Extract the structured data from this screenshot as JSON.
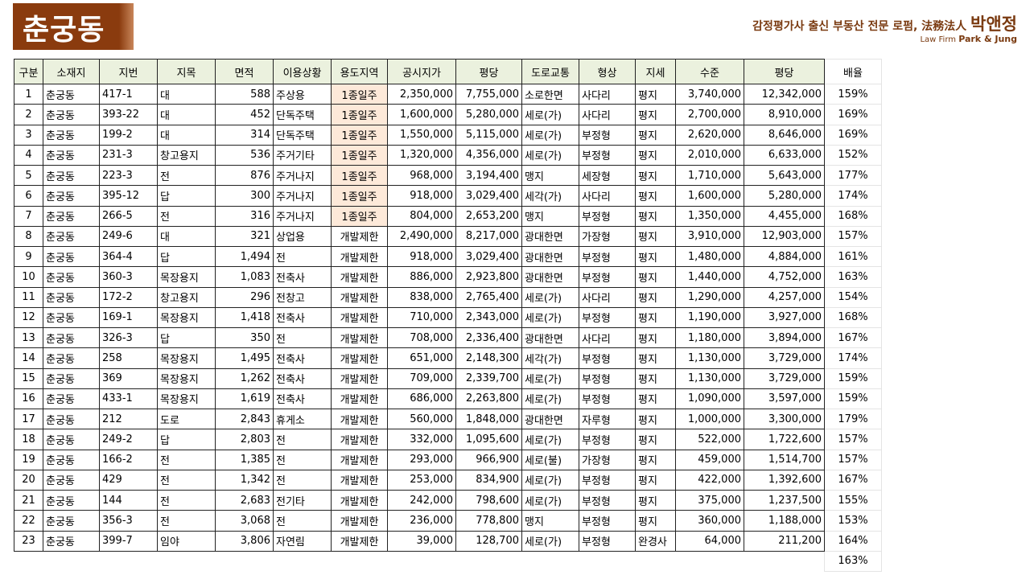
{
  "title": "춘궁동",
  "firm": {
    "line1": "감정평가사 출신 부동산 전문 로펌, 法務法人",
    "name": "박앤정",
    "line2_prefix": "Law Firm",
    "line2_name": "Park & Jung"
  },
  "headers": [
    "구분",
    "소재지",
    "지번",
    "지목",
    "면적",
    "이용상황",
    "용도지역",
    "공시지가",
    "평당",
    "도로교통",
    "형상",
    "지세",
    "수준",
    "평당",
    "배율"
  ],
  "rows": [
    {
      "no": "1",
      "no_red": true,
      "loc": "춘궁동",
      "lot": "417-1",
      "jimok": "대",
      "area": "588",
      "use": "주상용",
      "zone": "1종일주",
      "price": "2,350,000",
      "pp": "7,755,000",
      "road": "소로한면",
      "shape": "사다리",
      "terrain": "평지",
      "level": "3,740,000",
      "lpp": "12,342,000",
      "ratio": "159%"
    },
    {
      "no": "2",
      "no_red": true,
      "loc": "춘궁동",
      "lot": "393-22",
      "jimok": "대",
      "area": "452",
      "use": "단독주택",
      "zone": "1종일주",
      "price": "1,600,000",
      "pp": "5,280,000",
      "road": "세로(가)",
      "shape": "사다리",
      "terrain": "평지",
      "level": "2,700,000",
      "lpp": "8,910,000",
      "ratio": "169%"
    },
    {
      "no": "3",
      "no_red": false,
      "loc": "춘궁동",
      "lot": "199-2",
      "jimok": "대",
      "area": "314",
      "use": "단독주택",
      "zone": "1종일주",
      "price": "1,550,000",
      "pp": "5,115,000",
      "road": "세로(가)",
      "shape": "부정형",
      "terrain": "평지",
      "level": "2,620,000",
      "lpp": "8,646,000",
      "ratio": "169%"
    },
    {
      "no": "4",
      "no_red": true,
      "loc": "춘궁동",
      "lot": "231-3",
      "jimok": "창고용지",
      "area": "536",
      "use": "주거기타",
      "zone": "1종일주",
      "price": "1,320,000",
      "pp": "4,356,000",
      "road": "세로(가)",
      "shape": "부정형",
      "terrain": "평지",
      "level": "2,010,000",
      "lpp": "6,633,000",
      "ratio": "152%"
    },
    {
      "no": "5",
      "no_red": false,
      "loc": "춘궁동",
      "lot": "223-3",
      "jimok": "전",
      "area": "876",
      "use": "주거나지",
      "zone": "1종일주",
      "price": "968,000",
      "pp": "3,194,400",
      "road": "맹지",
      "shape": "세장형",
      "terrain": "평지",
      "level": "1,710,000",
      "lpp": "5,643,000",
      "ratio": "177%"
    },
    {
      "no": "6",
      "no_red": false,
      "loc": "춘궁동",
      "lot": "395-12",
      "jimok": "답",
      "area": "300",
      "use": "주거나지",
      "zone": "1종일주",
      "price": "918,000",
      "pp": "3,029,400",
      "road": "세각(가)",
      "shape": "사다리",
      "terrain": "평지",
      "level": "1,600,000",
      "lpp": "5,280,000",
      "ratio": "174%"
    },
    {
      "no": "7",
      "no_red": false,
      "loc": "춘궁동",
      "lot": "266-5",
      "jimok": "전",
      "area": "316",
      "use": "주거나지",
      "zone": "1종일주",
      "price": "804,000",
      "pp": "2,653,200",
      "road": "맹지",
      "shape": "부정형",
      "terrain": "평지",
      "level": "1,350,000",
      "lpp": "4,455,000",
      "ratio": "168%"
    },
    {
      "no": "8",
      "no_red": true,
      "loc": "춘궁동",
      "lot": "249-6",
      "jimok": "대",
      "area": "321",
      "use": "상업용",
      "zone": "개발제한",
      "price": "2,490,000",
      "pp": "8,217,000",
      "road": "광대한면",
      "shape": "가장형",
      "terrain": "평지",
      "level": "3,910,000",
      "lpp": "12,903,000",
      "ratio": "157%"
    },
    {
      "no": "9",
      "no_red": true,
      "loc": "춘궁동",
      "lot": "364-4",
      "jimok": "답",
      "area": "1,494",
      "use": "전",
      "zone": "개발제한",
      "price": "918,000",
      "pp": "3,029,400",
      "road": "광대한면",
      "shape": "부정형",
      "terrain": "평지",
      "level": "1,480,000",
      "lpp": "4,884,000",
      "ratio": "161%"
    },
    {
      "no": "10",
      "no_red": false,
      "loc": "춘궁동",
      "lot": "360-3",
      "jimok": "목장용지",
      "area": "1,083",
      "use": "전축사",
      "zone": "개발제한",
      "price": "886,000",
      "pp": "2,923,800",
      "road": "광대한면",
      "shape": "부정형",
      "terrain": "평지",
      "level": "1,440,000",
      "lpp": "4,752,000",
      "ratio": "163%"
    },
    {
      "no": "11",
      "no_red": false,
      "loc": "춘궁동",
      "lot": "172-2",
      "jimok": "창고용지",
      "area": "296",
      "use": "전창고",
      "zone": "개발제한",
      "price": "838,000",
      "pp": "2,765,400",
      "road": "세로(가)",
      "shape": "사다리",
      "terrain": "평지",
      "level": "1,290,000",
      "lpp": "4,257,000",
      "ratio": "154%"
    },
    {
      "no": "12",
      "no_red": true,
      "loc": "춘궁동",
      "lot": "169-1",
      "jimok": "목장용지",
      "area": "1,418",
      "use": "전축사",
      "zone": "개발제한",
      "price": "710,000",
      "pp": "2,343,000",
      "road": "세로(가)",
      "shape": "부정형",
      "terrain": "평지",
      "level": "1,190,000",
      "lpp": "3,927,000",
      "ratio": "168%"
    },
    {
      "no": "13",
      "no_red": false,
      "loc": "춘궁동",
      "lot": "326-3",
      "jimok": "답",
      "area": "350",
      "use": "전",
      "zone": "개발제한",
      "price": "708,000",
      "pp": "2,336,400",
      "road": "광대한면",
      "shape": "사다리",
      "terrain": "평지",
      "level": "1,180,000",
      "lpp": "3,894,000",
      "ratio": "167%"
    },
    {
      "no": "14",
      "no_red": false,
      "loc": "춘궁동",
      "lot": "258",
      "jimok": "목장용지",
      "area": "1,495",
      "use": "전축사",
      "zone": "개발제한",
      "price": "651,000",
      "pp": "2,148,300",
      "road": "세각(가)",
      "shape": "부정형",
      "terrain": "평지",
      "level": "1,130,000",
      "lpp": "3,729,000",
      "ratio": "174%"
    },
    {
      "no": "15",
      "no_red": true,
      "loc": "춘궁동",
      "lot": "369",
      "jimok": "목장용지",
      "area": "1,262",
      "use": "전축사",
      "zone": "개발제한",
      "price": "709,000",
      "pp": "2,339,700",
      "road": "세로(가)",
      "shape": "부정형",
      "terrain": "평지",
      "level": "1,130,000",
      "lpp": "3,729,000",
      "ratio": "159%"
    },
    {
      "no": "16",
      "no_red": false,
      "loc": "춘궁동",
      "lot": "433-1",
      "jimok": "목장용지",
      "area": "1,619",
      "use": "전축사",
      "zone": "개발제한",
      "price": "686,000",
      "pp": "2,263,800",
      "road": "세로(가)",
      "shape": "부정형",
      "terrain": "평지",
      "level": "1,090,000",
      "lpp": "3,597,000",
      "ratio": "159%"
    },
    {
      "no": "17",
      "no_red": false,
      "loc": "춘궁동",
      "lot": "212",
      "jimok": "도로",
      "area": "2,843",
      "use": "휴게소",
      "zone": "개발제한",
      "price": "560,000",
      "pp": "1,848,000",
      "road": "광대한면",
      "shape": "자루형",
      "terrain": "평지",
      "level": "1,000,000",
      "lpp": "3,300,000",
      "ratio": "179%"
    },
    {
      "no": "18",
      "no_red": false,
      "loc": "춘궁동",
      "lot": "249-2",
      "jimok": "답",
      "area": "2,803",
      "use": "전",
      "zone": "개발제한",
      "price": "332,000",
      "pp": "1,095,600",
      "road": "세로(가)",
      "shape": "부정형",
      "terrain": "평지",
      "level": "522,000",
      "lpp": "1,722,600",
      "ratio": "157%"
    },
    {
      "no": "19",
      "no_red": false,
      "loc": "춘궁동",
      "lot": "166-2",
      "jimok": "전",
      "area": "1,385",
      "use": "전",
      "zone": "개발제한",
      "price": "293,000",
      "pp": "966,900",
      "road": "세로(불)",
      "shape": "가장형",
      "terrain": "평지",
      "level": "459,000",
      "lpp": "1,514,700",
      "ratio": "157%"
    },
    {
      "no": "20",
      "no_red": false,
      "loc": "춘궁동",
      "lot": "429",
      "jimok": "전",
      "area": "1,342",
      "use": "전",
      "zone": "개발제한",
      "price": "253,000",
      "pp": "834,900",
      "road": "세로(가)",
      "shape": "부정형",
      "terrain": "평지",
      "level": "422,000",
      "lpp": "1,392,600",
      "ratio": "167%"
    },
    {
      "no": "21",
      "no_red": false,
      "loc": "춘궁동",
      "lot": "144",
      "jimok": "전",
      "area": "2,683",
      "use": "전기타",
      "zone": "개발제한",
      "price": "242,000",
      "pp": "798,600",
      "road": "세로(가)",
      "shape": "부정형",
      "terrain": "평지",
      "level": "375,000",
      "lpp": "1,237,500",
      "ratio": "155%"
    },
    {
      "no": "22",
      "no_red": false,
      "loc": "춘궁동",
      "lot": "356-3",
      "jimok": "전",
      "area": "3,068",
      "use": "전",
      "zone": "개발제한",
      "price": "236,000",
      "pp": "778,800",
      "road": "맹지",
      "shape": "부정형",
      "terrain": "평지",
      "level": "360,000",
      "lpp": "1,188,000",
      "ratio": "153%"
    },
    {
      "no": "23",
      "no_red": false,
      "loc": "춘궁동",
      "lot": "399-7",
      "jimok": "임야",
      "area": "3,806",
      "use": "자연림",
      "zone": "개발제한",
      "price": "39,000",
      "pp": "128,700",
      "road": "세로(가)",
      "shape": "부정형",
      "terrain": "완경사",
      "level": "64,000",
      "lpp": "211,200",
      "ratio": "164%"
    }
  ],
  "average_ratio": "163%",
  "colors": {
    "title_bg": "#8a3b0e",
    "header_bg": "#ebf1de",
    "zone_highlight": "#fde9d9",
    "red_no": "#d41919",
    "price_blue": "#1f2d8a"
  }
}
